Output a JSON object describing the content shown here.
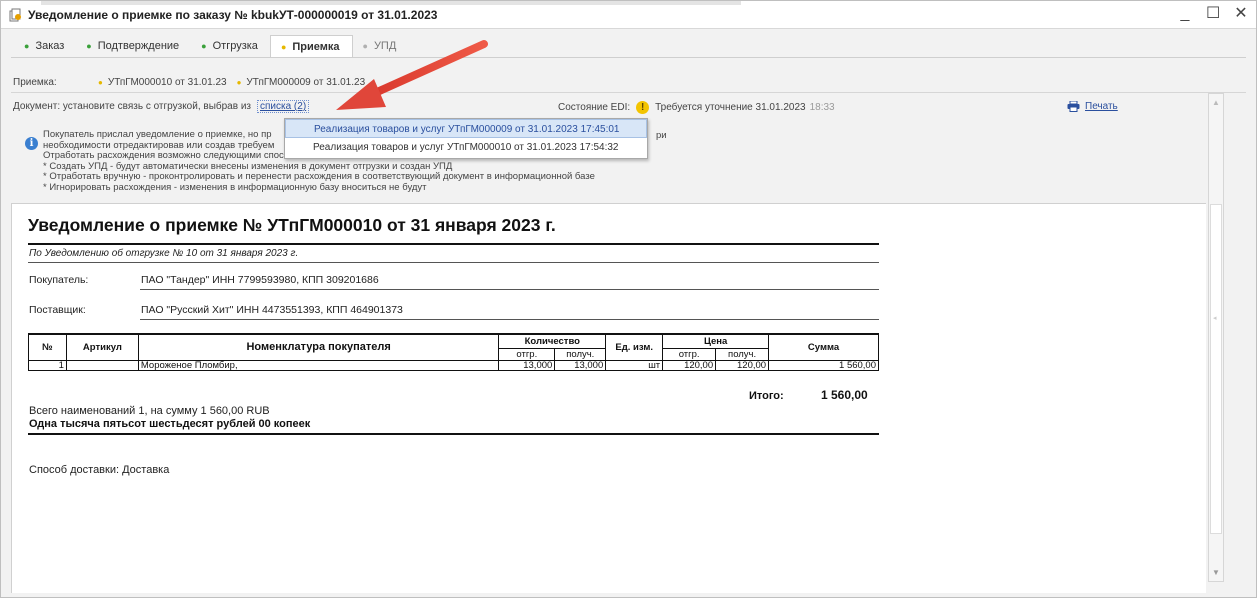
{
  "window": {
    "title": "Уведомление о приемке по заказу № kbukУТ-000000019 от 31.01.2023",
    "controls": {
      "minimize": "_",
      "maximize": "☐",
      "close": "✕"
    }
  },
  "tabs": [
    {
      "label": "Заказ",
      "state": "done"
    },
    {
      "label": "Подтверждение",
      "state": "done"
    },
    {
      "label": "Отгрузка",
      "state": "done"
    },
    {
      "label": "Приемка",
      "state": "active"
    },
    {
      "label": "УПД",
      "state": "inactive"
    }
  ],
  "acceptance": {
    "label": "Приемка:",
    "links": [
      "УТпГМ000010 от 31.01.23",
      "УТпГМ000009 от 31.01.23"
    ]
  },
  "document_row": {
    "label": "Документ:  установите связь с отгрузкой, выбрав из",
    "link": "списка (2)"
  },
  "edi": {
    "label": "Состояние EDI:",
    "status": "Требуется уточнение",
    "date": "31.01.2023",
    "time": "18:33"
  },
  "print_link": "Печать",
  "info": {
    "lines": [
      "Покупатель прислал уведомление о приемке, но пр",
      "необходимости отредактировав или создав требуем",
      "Отработать расхождения возможно следующими способами:",
      "* Создать УПД - будут автоматически внесены изменения в документ отгрузки и создан УПД",
      "* Отработать вручную - проконтролировать и перенести расхождения в соответствующий документ в информационной базе",
      "* Игнорировать расхождения - изменения в информационную базу вноситься не будут"
    ],
    "tail": "ри"
  },
  "dropdown": {
    "items": [
      "Реализация товаров и услуг УТпГМ000009 от 31.01.2023 17:45:01",
      "Реализация товаров и услуг УТпГМ000010 от 31.01.2023 17:54:32"
    ]
  },
  "report": {
    "title": "Уведомление о приемке № УТпГМ000010 от 31 января 2023 г.",
    "basis": "По Уведомлению об отгрузке № 10 от 31 января 2023 г.",
    "buyer_label": "Покупатель:",
    "buyer_value": "ПАО \"Тандер\"     ИНН 7799593980, КПП 309201686",
    "supplier_label": "Поставщик:",
    "supplier_value": "ПАО \"Русский Хит\"   ИНН 4473551393, КПП 464901373",
    "table": {
      "headers": {
        "num": "№",
        "article": "Артикул",
        "nomenclature": "Номенклатура покупателя",
        "quantity": "Количество",
        "qty_shipped": "отгр.",
        "qty_received": "получ.",
        "unit": "Ед. изм.",
        "price": "Цена",
        "price_shipped": "отгр.",
        "price_received": "получ.",
        "sum": "Сумма"
      },
      "rows": [
        {
          "num": "1",
          "article": "",
          "nomenclature": "Мороженое Пломбир,",
          "qty_shipped": "13,000",
          "qty_received": "13,000",
          "unit": "шт",
          "price_shipped": "120,00",
          "price_received": "120,00",
          "sum": "1 560,00"
        }
      ]
    },
    "total_label": "Итого:",
    "total_value": "1 560,00",
    "sum_line": "Всего наименований 1, на сумму 1 560,00 RUB",
    "sum_words": "Одна тысяча пятьсот шестьдесят рублей 00 копеек",
    "delivery": "Способ доставки: Доставка"
  },
  "colors": {
    "link": "#2a4f9e",
    "active_tab_dot": "#e6b800",
    "done_tab_dot": "#3aa03a",
    "warning": "#f3c400",
    "info": "#3a7fd0",
    "arrow": "#e0463a"
  }
}
